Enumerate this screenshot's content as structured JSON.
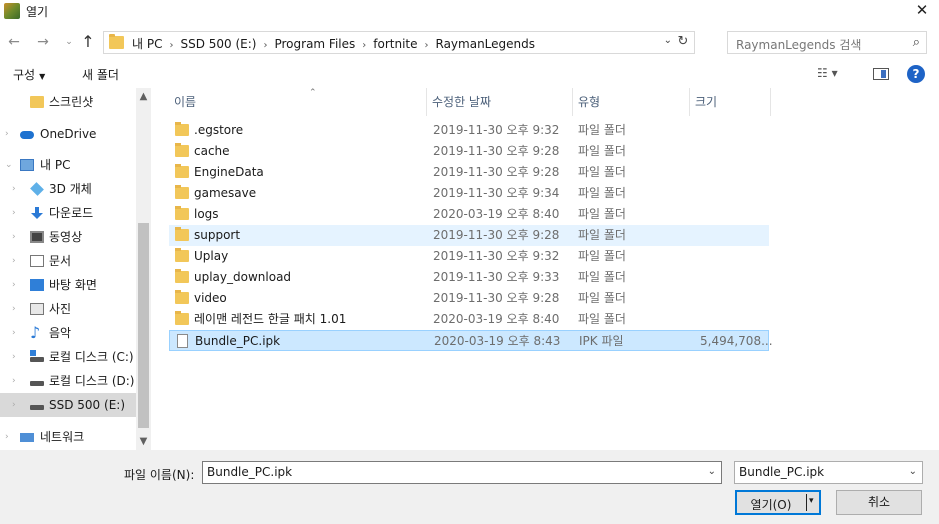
{
  "window": {
    "title": "열기",
    "close_glyph": "✕"
  },
  "nav": {
    "back_glyph": "←",
    "forward_glyph": "→",
    "recent_glyph": "⌄",
    "up_glyph": "↑",
    "breadcrumbs": [
      "내 PC",
      "SSD 500 (E:)",
      "Program Files",
      "fortnite",
      "RaymanLegends"
    ],
    "separator_glyph": "›",
    "dropdown_glyph": "⌄",
    "refresh_glyph": "↻",
    "search_placeholder": "RaymanLegends 검색",
    "search_glyph": "⌕"
  },
  "toolbar": {
    "organize_label": "구성",
    "organize_caret": "▼",
    "new_folder_label": "새 폴더",
    "view_glyph": "☷ ▾",
    "help_glyph": "?"
  },
  "sidebar": {
    "items": [
      {
        "label": "스크린샷",
        "icon": "folder-icon"
      },
      {
        "label": "OneDrive",
        "icon": "cloud-icon"
      },
      {
        "label": "내 PC",
        "icon": "computer-icon"
      },
      {
        "label": "3D 개체",
        "icon": "cube-3d-icon"
      },
      {
        "label": "다운로드",
        "icon": "download-icon"
      },
      {
        "label": "동영상",
        "icon": "video-icon"
      },
      {
        "label": "문서",
        "icon": "document-icon"
      },
      {
        "label": "바탕 화면",
        "icon": "desktop-icon"
      },
      {
        "label": "사진",
        "icon": "picture-icon"
      },
      {
        "label": "음악",
        "icon": "music-icon"
      },
      {
        "label": "로컬 디스크 (C:)",
        "icon": "windows-drive-icon"
      },
      {
        "label": "로컬 디스크 (D:)",
        "icon": "drive-icon"
      },
      {
        "label": "SSD 500 (E:)",
        "icon": "drive-icon"
      },
      {
        "label": "네트워크",
        "icon": "network-icon"
      }
    ],
    "expander_glyph": "›",
    "expanded_glyph": "⌄",
    "scroll_up_glyph": "▲",
    "scroll_down_glyph": "▼"
  },
  "columns": {
    "name": "이름",
    "date": "수정한 날짜",
    "type": "유형",
    "size": "크기",
    "sort_glyph": "⌃"
  },
  "files": [
    {
      "name": ".egstore",
      "date": "2019-11-30 오후 9:32",
      "type": "파일 폴더",
      "size": "",
      "kind": "folder"
    },
    {
      "name": "cache",
      "date": "2019-11-30 오후 9:28",
      "type": "파일 폴더",
      "size": "",
      "kind": "folder"
    },
    {
      "name": "EngineData",
      "date": "2019-11-30 오후 9:28",
      "type": "파일 폴더",
      "size": "",
      "kind": "folder"
    },
    {
      "name": "gamesave",
      "date": "2019-11-30 오후 9:34",
      "type": "파일 폴더",
      "size": "",
      "kind": "folder"
    },
    {
      "name": "logs",
      "date": "2020-03-19 오후 8:40",
      "type": "파일 폴더",
      "size": "",
      "kind": "folder"
    },
    {
      "name": "support",
      "date": "2019-11-30 오후 9:28",
      "type": "파일 폴더",
      "size": "",
      "kind": "folder"
    },
    {
      "name": "Uplay",
      "date": "2019-11-30 오후 9:32",
      "type": "파일 폴더",
      "size": "",
      "kind": "folder"
    },
    {
      "name": "uplay_download",
      "date": "2019-11-30 오후 9:33",
      "type": "파일 폴더",
      "size": "",
      "kind": "folder"
    },
    {
      "name": "video",
      "date": "2019-11-30 오후 9:28",
      "type": "파일 폴더",
      "size": "",
      "kind": "folder"
    },
    {
      "name": "레이맨 레전드 한글 패치 1.01",
      "date": "2020-03-19 오후 8:40",
      "type": "파일 폴더",
      "size": "",
      "kind": "folder"
    },
    {
      "name": "Bundle_PC.ipk",
      "date": "2020-03-19 오후 8:43",
      "type": "IPK 파일",
      "size": "5,494,708...",
      "kind": "file"
    }
  ],
  "footer": {
    "filename_label": "파일 이름(N):",
    "filename_value": "Bundle_PC.ipk",
    "filetype_value": "Bundle_PC.ipk",
    "dropdown_glyph": "⌄",
    "open_label": "열기(O)",
    "open_caret": "▾",
    "cancel_label": "취소"
  },
  "colors": {
    "hover_row": "#e5f3ff",
    "selected_row": "#cce8ff",
    "accent": "#0078d7",
    "folder": "#f2c759"
  }
}
